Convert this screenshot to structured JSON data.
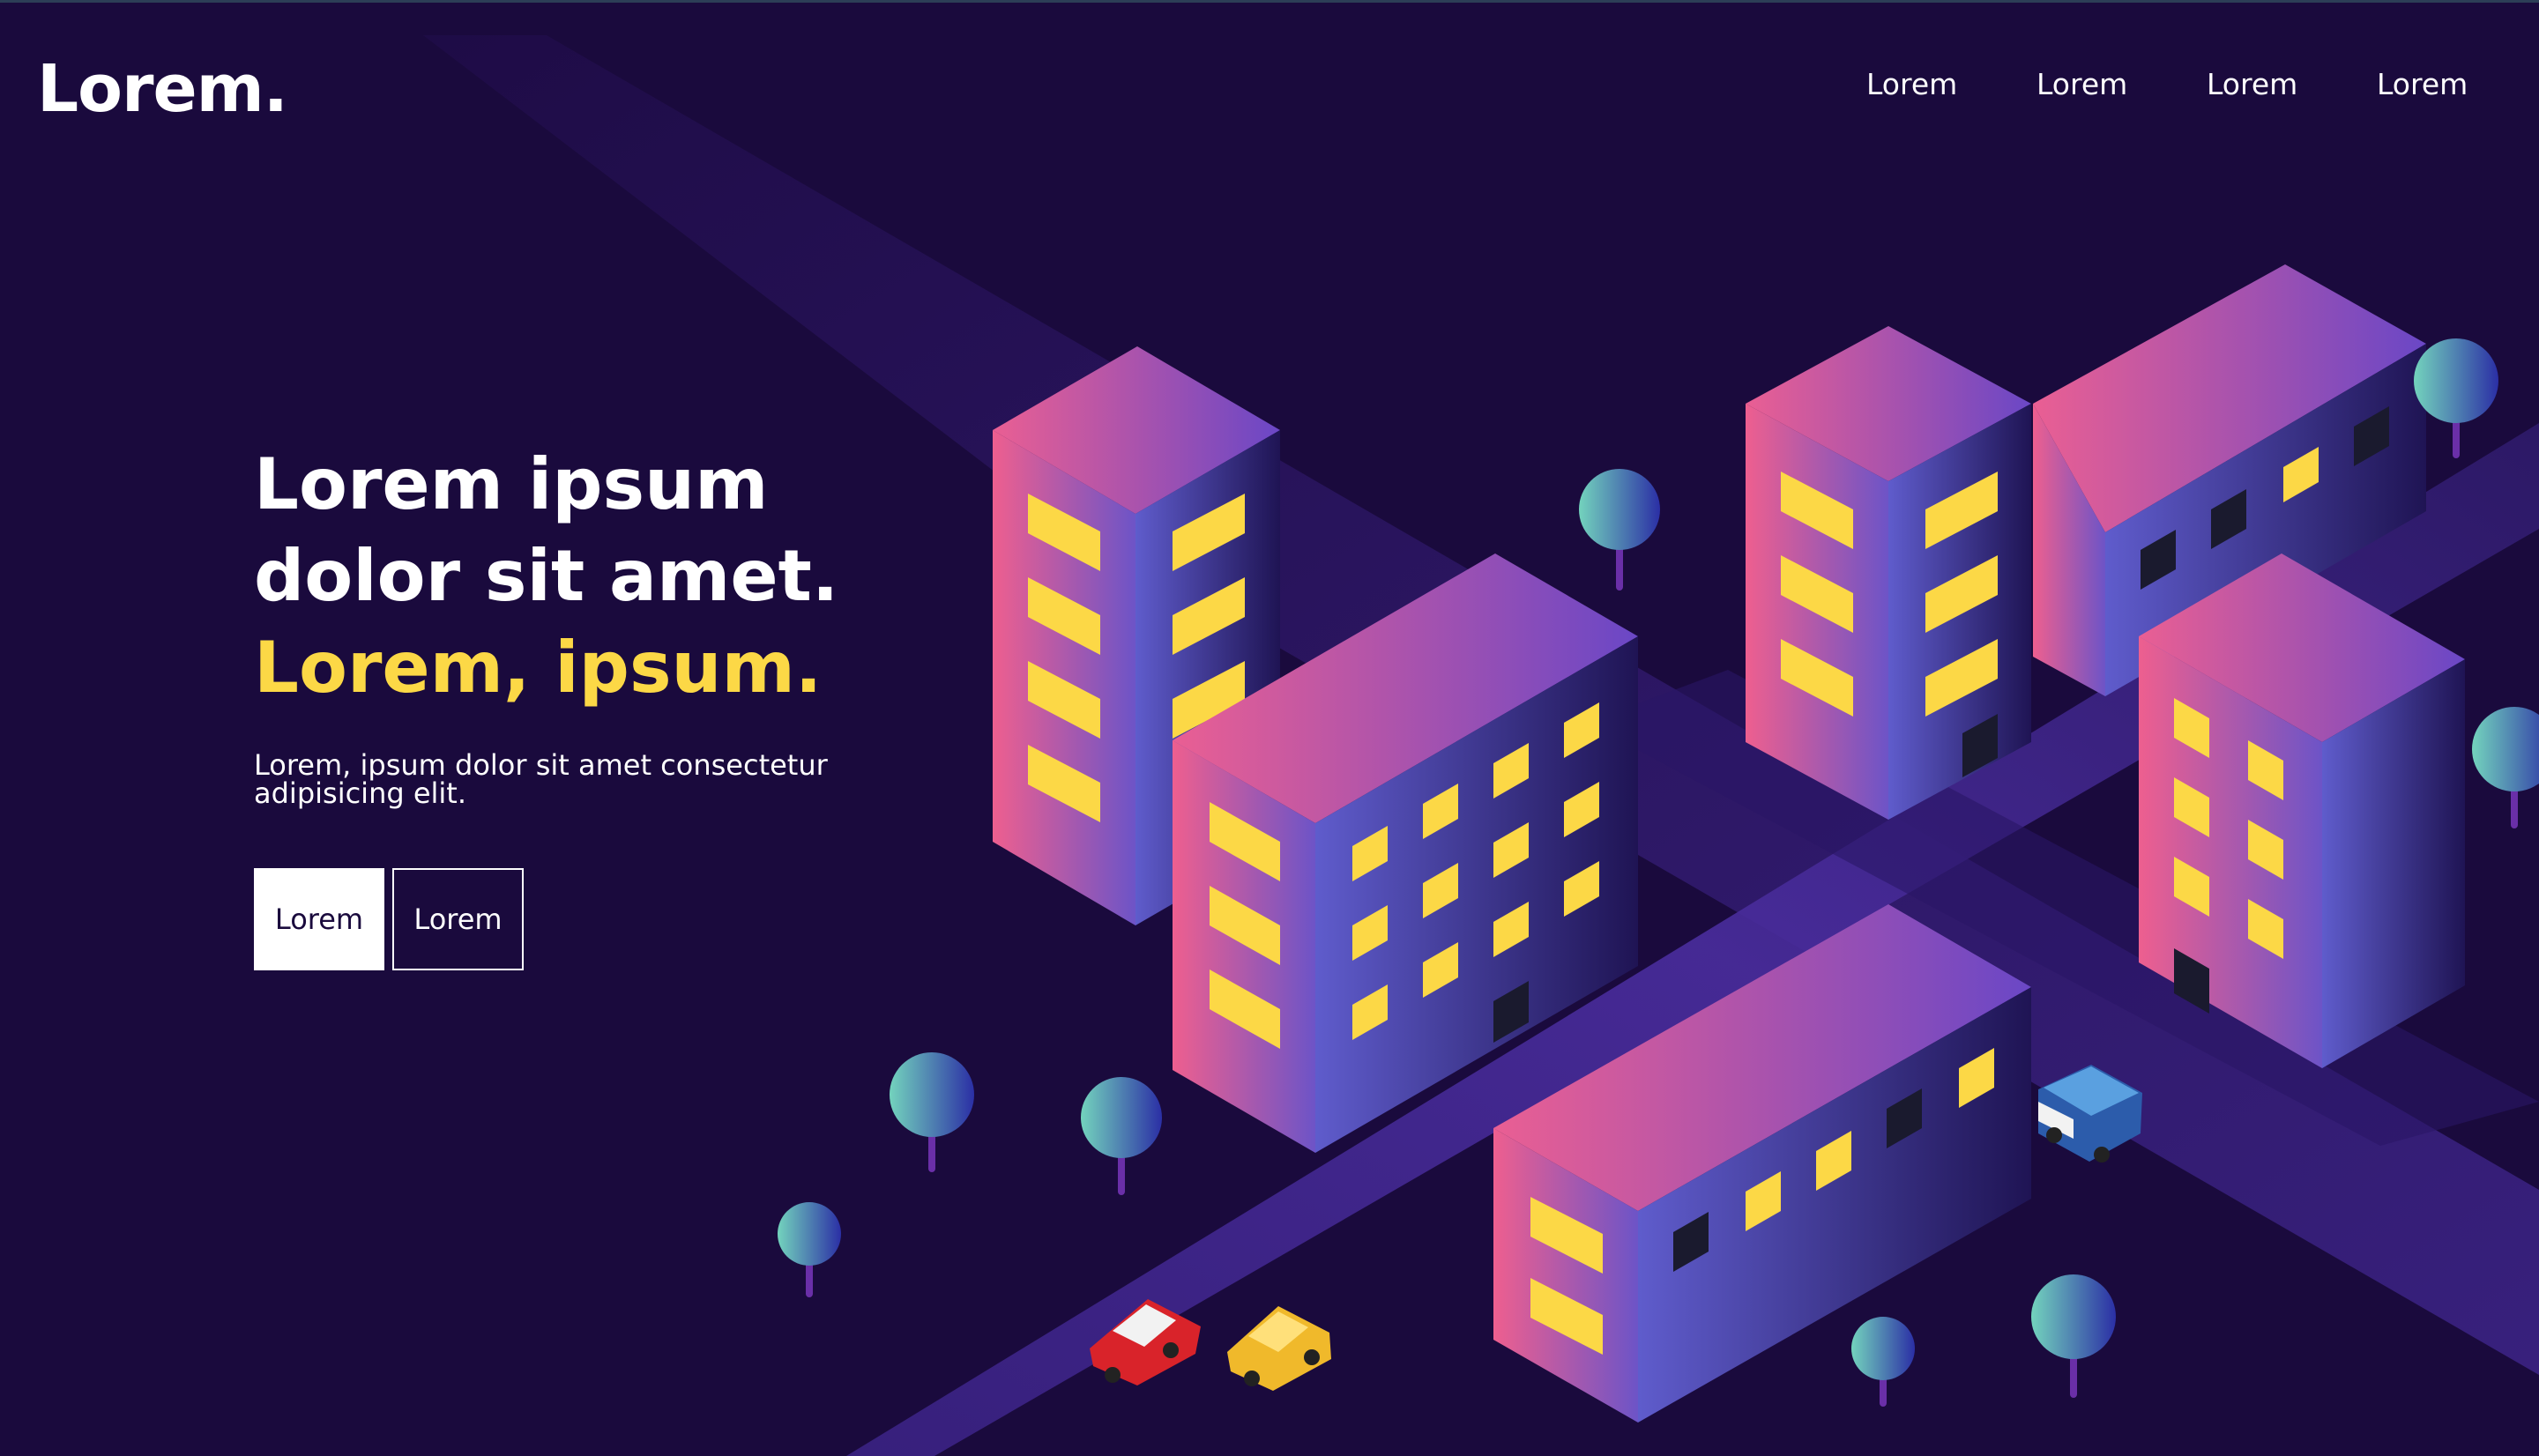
{
  "header": {
    "logo": "Lorem.",
    "nav": [
      {
        "label": "Lorem"
      },
      {
        "label": "Lorem"
      },
      {
        "label": "Lorem"
      },
      {
        "label": "Lorem"
      }
    ]
  },
  "hero": {
    "title_line1": "Lorem ipsum",
    "title_line2": "dolor sit amet.",
    "title_accent": "Lorem, ipsum.",
    "description": "Lorem, ipsum dolor sit amet consectetur adipisicing elit.",
    "primary_button": "Lorem",
    "secondary_button": "Lorem"
  },
  "colors": {
    "background": "#1a0a3d",
    "accent_yellow": "#fcd846",
    "building_pink": "#e85d9a",
    "building_purple": "#7c4dcc",
    "building_blue": "#4b46b8"
  },
  "illustration": {
    "icons": [
      "building-icon",
      "tree-icon",
      "car-icon",
      "van-icon",
      "road-icon"
    ]
  }
}
